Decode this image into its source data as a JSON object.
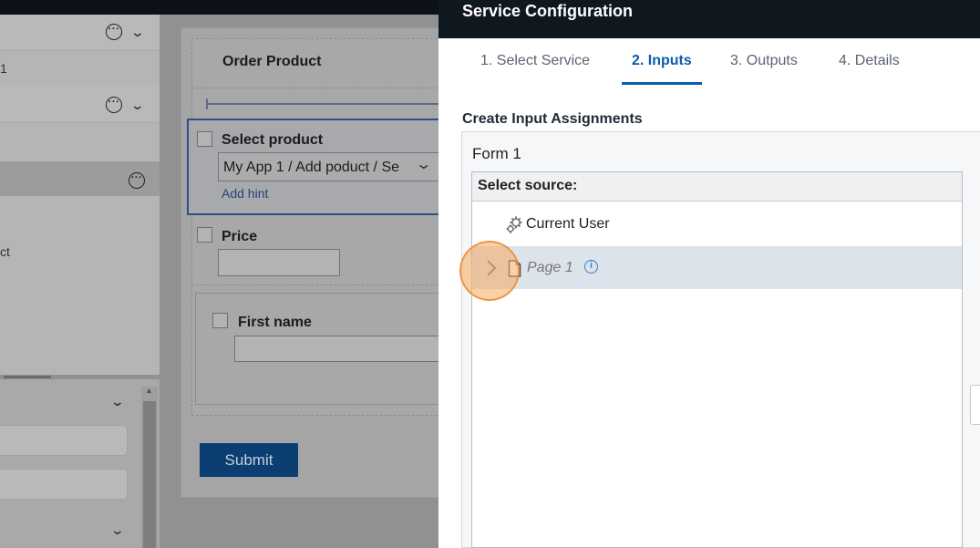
{
  "background": {
    "left_panel": {
      "row1_value": "1",
      "row_partial_text": "ct"
    },
    "form": {
      "title": "Order Product",
      "select_product_label": "Select product",
      "select_product_value": "My App 1 / Add poduct / Se",
      "add_hint": "Add hint",
      "price_label": "Price",
      "first_name_label": "First name",
      "submit_label": "Submit"
    }
  },
  "modal": {
    "title": "Service Configuration",
    "tabs": [
      {
        "label": "1. Select Service",
        "active": false
      },
      {
        "label": "2. Inputs",
        "active": true
      },
      {
        "label": "3. Outputs",
        "active": false
      },
      {
        "label": "4. Details",
        "active": false
      }
    ],
    "section_title": "Create Input Assignments",
    "form_label": "Form 1",
    "tree": {
      "header": "Select source:",
      "items": [
        {
          "label": "Current User",
          "icon": "gears-icon"
        },
        {
          "label": "Page 1",
          "icon": "page-icon",
          "info": true,
          "selected": true
        }
      ]
    }
  },
  "colors": {
    "accent": "#0b5cab",
    "modal_header": "#10181f",
    "submit": "#0b3f74",
    "selected_row": "#dde3ea",
    "click_marker": "#f5aa5f"
  }
}
